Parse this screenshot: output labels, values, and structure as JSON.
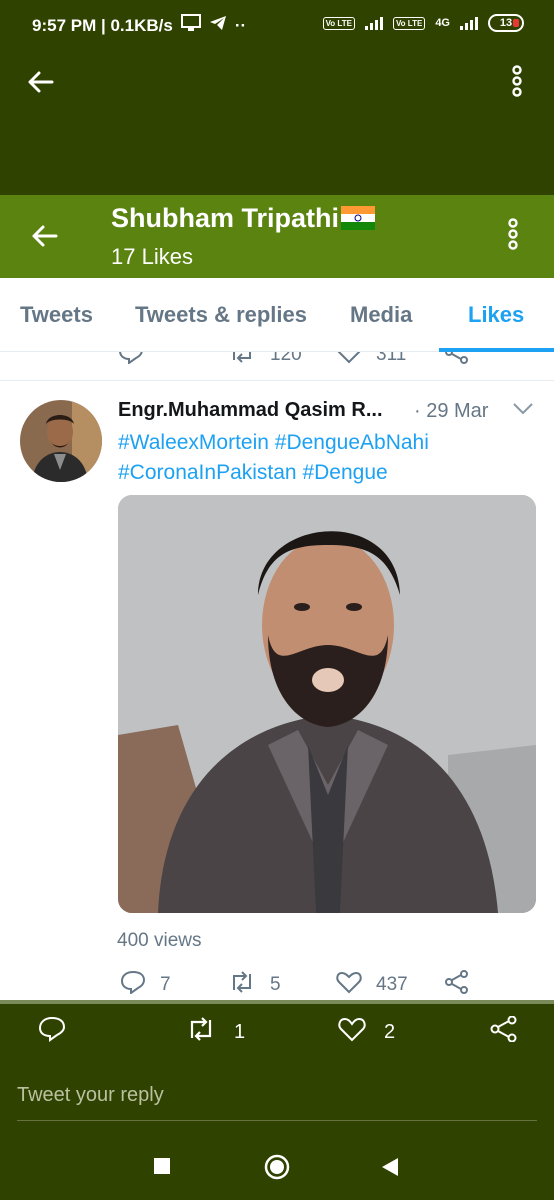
{
  "status_bar": {
    "time_speed": "9:57 PM | 0.1KB/s",
    "tag1": "Vo LTE",
    "tag2": "Vo LTE",
    "net": "4G",
    "battery": "13"
  },
  "header": {
    "name": "Shubham Tripathi",
    "likes_count": "17 Likes"
  },
  "tabs": [
    "Tweets",
    "Tweets & replies",
    "Media",
    "Likes"
  ],
  "active_tab": "Likes",
  "previous_tweet": {
    "retweets": "120",
    "likes": "311"
  },
  "tweet": {
    "author": "Engr.Muhammad Qasim R...",
    "date": "· 29 Mar",
    "hashtags_line1": "#WaleexMortein #DengueAbNahi",
    "hashtags_line2": "#CoronaInPakistan #Dengue",
    "views": "400 views",
    "replies": "7",
    "retweets": "5",
    "likes": "437"
  },
  "bottom_actions": {
    "retweets": "1",
    "likes": "2"
  },
  "reply_placeholder": "Tweet your reply",
  "colors": {
    "dark_bar": "#2f4200",
    "header_green": "#5a8310",
    "twitter_blue": "#1da1f2",
    "gray_text": "#657786"
  },
  "icons": [
    "back-arrow-icon",
    "more-vertical-icon",
    "reply-icon",
    "retweet-icon",
    "like-icon",
    "share-icon",
    "chevron-down-icon",
    "nav-square-icon",
    "nav-circle-icon",
    "nav-triangle-icon"
  ]
}
